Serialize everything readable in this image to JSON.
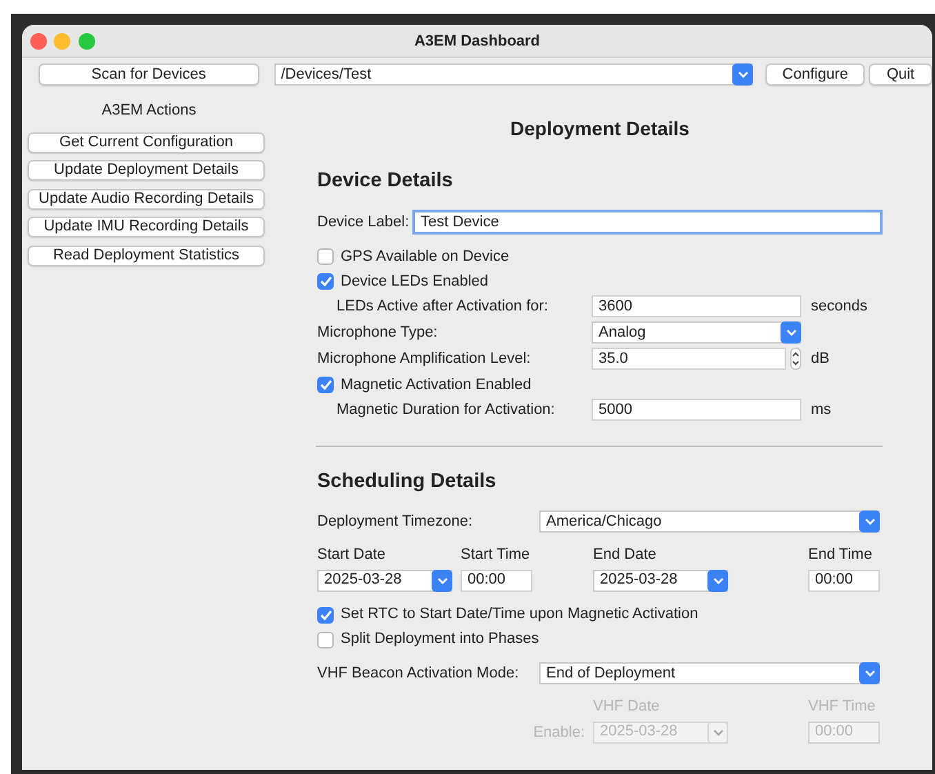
{
  "window": {
    "title": "A3EM Dashboard"
  },
  "toolbar": {
    "scan_button": "Scan for Devices",
    "device_path": "/Devices/Test",
    "buttons": [
      "Configure",
      "Quit"
    ]
  },
  "sidebar": {
    "heading": "A3EM Actions",
    "actions": [
      "Get Current Configuration",
      "Update Deployment Details",
      "Update Audio Recording Details",
      "Update IMU Recording Details",
      "Read Deployment Statistics"
    ]
  },
  "main": {
    "title": "Deployment Details"
  },
  "device_details": {
    "heading": "Device Details",
    "device_label": {
      "label": "Device Label:",
      "value": "Test Device",
      "focused": true
    },
    "rows": [
      {
        "kind": "checkbox",
        "label": "GPS Available on Device",
        "checked": false
      },
      {
        "kind": "checkbox",
        "label": "Device LEDs Enabled",
        "checked": true,
        "children": [
          {
            "kind": "text",
            "label": "LEDs Active after Activation for:",
            "value": "3600",
            "unit": "seconds"
          }
        ]
      },
      {
        "kind": "select",
        "label": "Microphone Type:",
        "value": "Analog"
      },
      {
        "kind": "spin",
        "label": "Microphone Amplification Level:",
        "value": "35.0",
        "unit": "dB"
      },
      {
        "kind": "checkbox",
        "label": "Magnetic Activation Enabled",
        "checked": true,
        "children": [
          {
            "kind": "text",
            "label": "Magnetic Duration for Activation:",
            "value": "5000",
            "unit": "ms"
          }
        ]
      }
    ]
  },
  "scheduling": {
    "heading": "Scheduling Details",
    "timezone": {
      "label": "Deployment Timezone:",
      "value": "America/Chicago"
    },
    "dates": [
      {
        "kind": "date",
        "label": "Start Date",
        "value": "2025-03-28"
      },
      {
        "kind": "time",
        "label": "Start Time",
        "value": "00:00"
      },
      {
        "kind": "date",
        "label": "End Date",
        "value": "2025-03-28"
      },
      {
        "kind": "time",
        "label": "End Time",
        "value": "00:00"
      }
    ],
    "checkboxes": [
      {
        "label": "Set RTC to Start Date/Time upon Magnetic Activation",
        "checked": true
      },
      {
        "label": "Split Deployment into Phases",
        "checked": false
      }
    ],
    "vhf_mode": {
      "label": "VHF Beacon Activation Mode:",
      "value": "End of Deployment"
    },
    "vhf": {
      "enable_label": "Enable:",
      "disabled": true,
      "fields": [
        {
          "kind": "date",
          "label": "VHF Date",
          "value": "2025-03-28"
        },
        {
          "kind": "time",
          "label": "VHF Time",
          "value": "00:00"
        }
      ]
    }
  }
}
